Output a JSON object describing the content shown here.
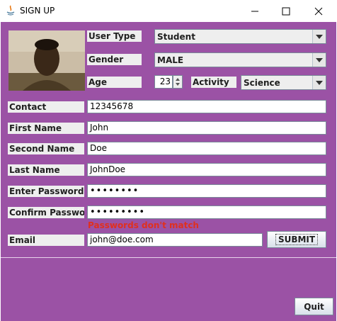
{
  "window": {
    "title": "SIGN UP"
  },
  "form": {
    "user_type": {
      "label": "User Type",
      "value": "Student"
    },
    "gender": {
      "label": "Gender",
      "value": "MALE"
    },
    "age": {
      "label": "Age",
      "value": "23"
    },
    "activity": {
      "label": "Activity",
      "value": "Science"
    },
    "contact": {
      "label": "Contact",
      "value": "12345678"
    },
    "first_name": {
      "label": "First Name",
      "value": "John"
    },
    "second_name": {
      "label": "Second Name",
      "value": "Doe"
    },
    "last_name": {
      "label": "Last Name",
      "value": "JohnDoe"
    },
    "enter_password": {
      "label": "Enter Password",
      "value": "••••••••"
    },
    "confirm_password": {
      "label": "Confirm Password",
      "value": "•••••••••"
    },
    "error": "Passwords don't match",
    "email": {
      "label": "Email",
      "value": "john@doe.com"
    },
    "submit_label": "SUBMIT"
  },
  "footer": {
    "quit_label": "Quit"
  },
  "colors": {
    "panel": "#9b52a5",
    "error": "#e0301e"
  }
}
